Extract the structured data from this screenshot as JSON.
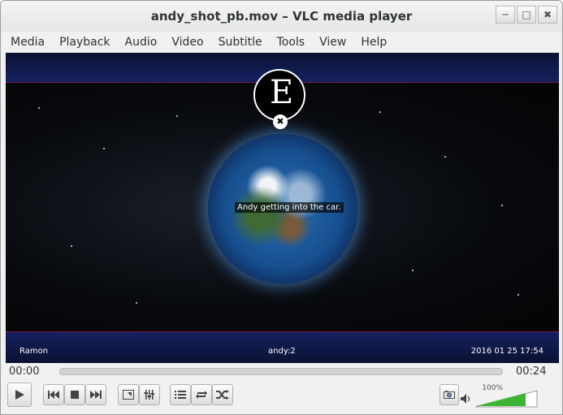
{
  "window": {
    "title": "andy_shot_pb.mov – VLC media player"
  },
  "window_controls": {
    "minimize": "─",
    "maximize": "□",
    "close": "✖"
  },
  "menu": [
    "Media",
    "Playback",
    "Audio",
    "Video",
    "Subtitle",
    "Tools",
    "View",
    "Help"
  ],
  "video": {
    "subtitle": "Andy getting into the car.",
    "caption_left": "Ramon",
    "caption_center": "andy:2",
    "caption_right": "2016 01 25 17:54"
  },
  "playback": {
    "elapsed": "00:00",
    "total": "00:24",
    "progress": 0.0
  },
  "volume": {
    "label": "100%",
    "level": 1.0
  },
  "icons": {
    "play": "play-icon",
    "prev": "previous-icon",
    "stop": "stop-icon",
    "next": "next-icon",
    "fullscreen": "fullscreen-icon",
    "extended": "extended-settings-icon",
    "playlist": "playlist-icon",
    "loop": "loop-icon",
    "shuffle": "shuffle-icon",
    "snapshot": "snapshot-icon",
    "speaker": "speaker-icon"
  }
}
